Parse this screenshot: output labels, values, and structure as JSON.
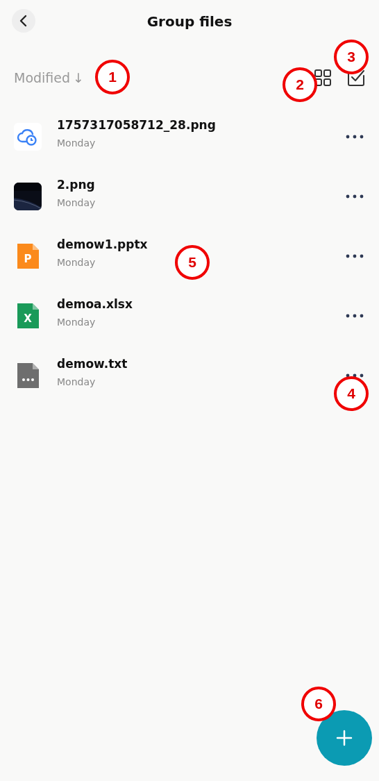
{
  "header": {
    "title": "Group files"
  },
  "sort": {
    "label": "Modified",
    "arrow": "↓"
  },
  "files": [
    {
      "name": "1757317058712_28.png",
      "date": "Monday",
      "kind": "cloud-image"
    },
    {
      "name": "2.png",
      "date": "Monday",
      "kind": "picture"
    },
    {
      "name": "demow1.pptx",
      "date": "Monday",
      "kind": "pptx",
      "badge": "P"
    },
    {
      "name": "demoa.xlsx",
      "date": "Monday",
      "kind": "xlsx",
      "badge": "X"
    },
    {
      "name": "demow.txt",
      "date": "Monday",
      "kind": "txt"
    }
  ],
  "annotations": [
    {
      "label": "1"
    },
    {
      "label": "2"
    },
    {
      "label": "3"
    },
    {
      "label": "4"
    },
    {
      "label": "5"
    },
    {
      "label": "6"
    }
  ]
}
